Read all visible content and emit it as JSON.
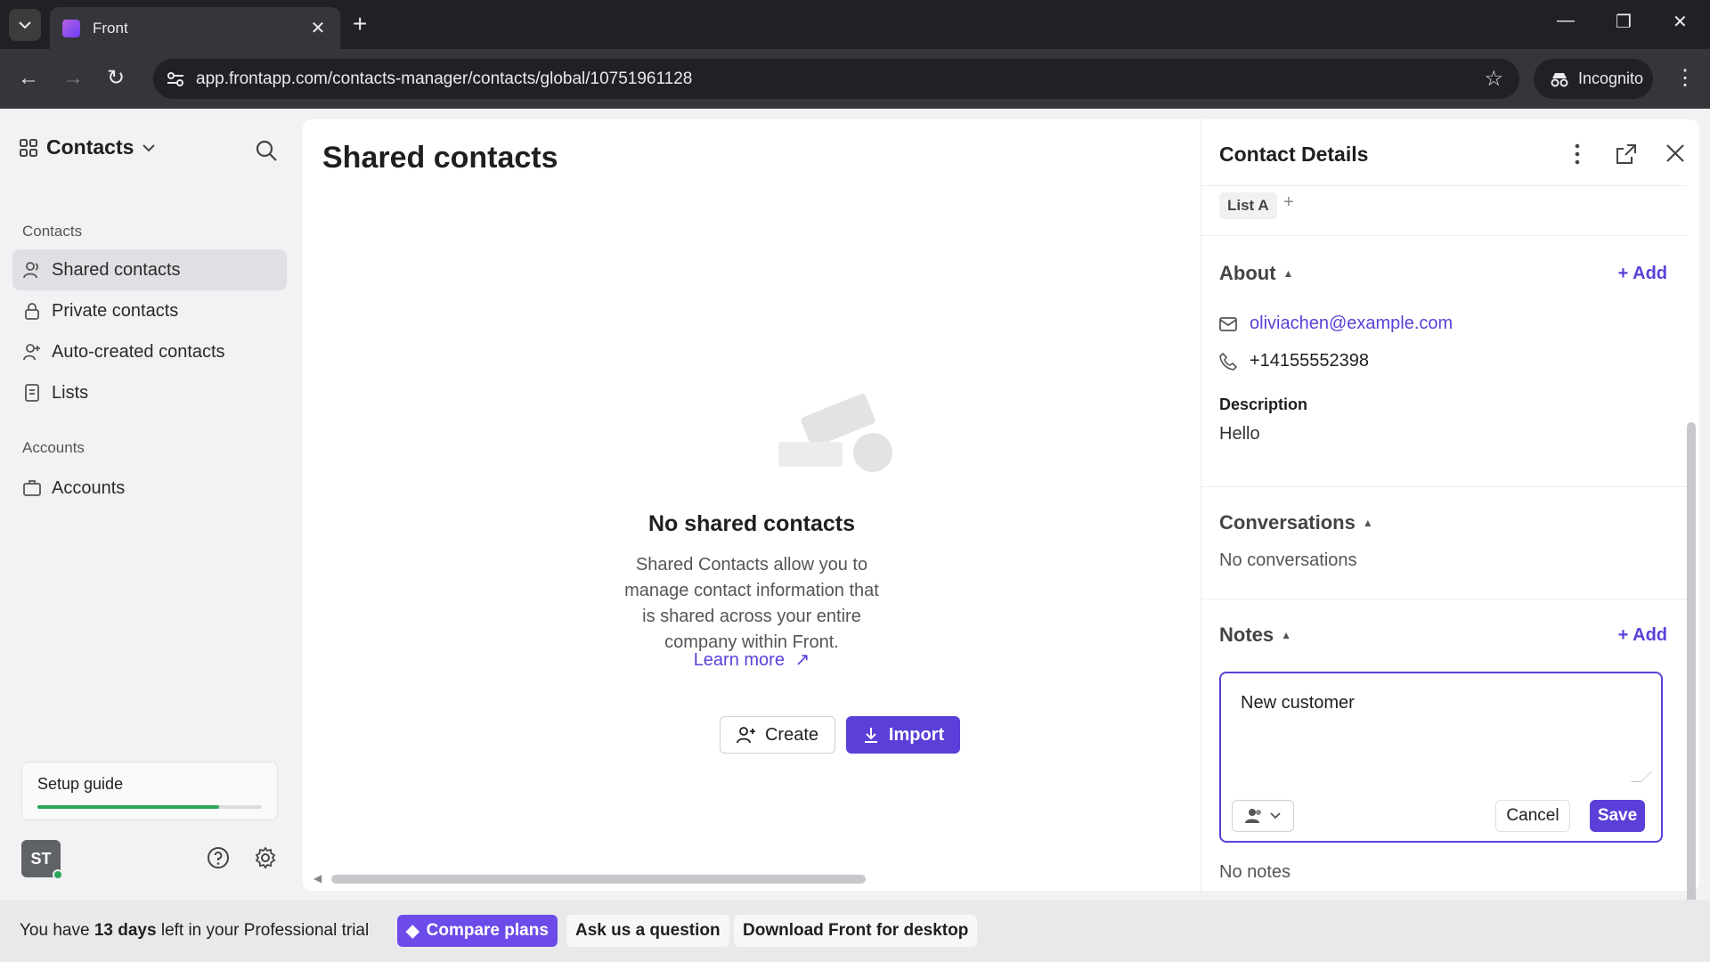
{
  "browser": {
    "tab_title": "Front",
    "url": "app.frontapp.com/contacts-manager/contacts/global/10751961128",
    "incognito_label": "Incognito"
  },
  "sidebar": {
    "title": "Contacts",
    "section_contacts": "Contacts",
    "items": [
      {
        "label": "Shared contacts",
        "icon": "person-icon",
        "active": true
      },
      {
        "label": "Private contacts",
        "icon": "lock-icon",
        "active": false
      },
      {
        "label": "Auto-created contacts",
        "icon": "person-auto-icon",
        "active": false
      },
      {
        "label": "Lists",
        "icon": "list-icon",
        "active": false
      }
    ],
    "section_accounts": "Accounts",
    "accounts_item": "Accounts",
    "setup_guide": {
      "label": "Setup guide",
      "progress": 0.81
    },
    "avatar_initials": "ST"
  },
  "main": {
    "title": "Shared contacts",
    "empty_title": "No shared contacts",
    "empty_description": "Shared Contacts allow you to manage contact information that is shared across your entire company within Front.",
    "learn_more": "Learn more",
    "create_label": "Create",
    "import_label": "Import"
  },
  "details": {
    "title": "Contact Details",
    "list_tag": "List A",
    "about": {
      "heading": "About",
      "add_label": "+ Add",
      "email": "oliviachen@example.com",
      "phone": "+14155552398",
      "description_label": "Description",
      "description_value": "Hello"
    },
    "conversations": {
      "heading": "Conversations",
      "empty": "No conversations"
    },
    "notes": {
      "heading": "Notes",
      "add_label": "+ Add",
      "draft": "New customer",
      "cancel_label": "Cancel",
      "save_label": "Save",
      "empty": "No notes"
    }
  },
  "trial": {
    "prefix": "You have ",
    "days": "13 days",
    "suffix": " left in your Professional trial",
    "compare_label": "Compare plans",
    "ask_label": "Ask us a question",
    "download_label": "Download Front for desktop"
  },
  "colors": {
    "accent": "#5b3fd8",
    "progress": "#2aa55a"
  }
}
